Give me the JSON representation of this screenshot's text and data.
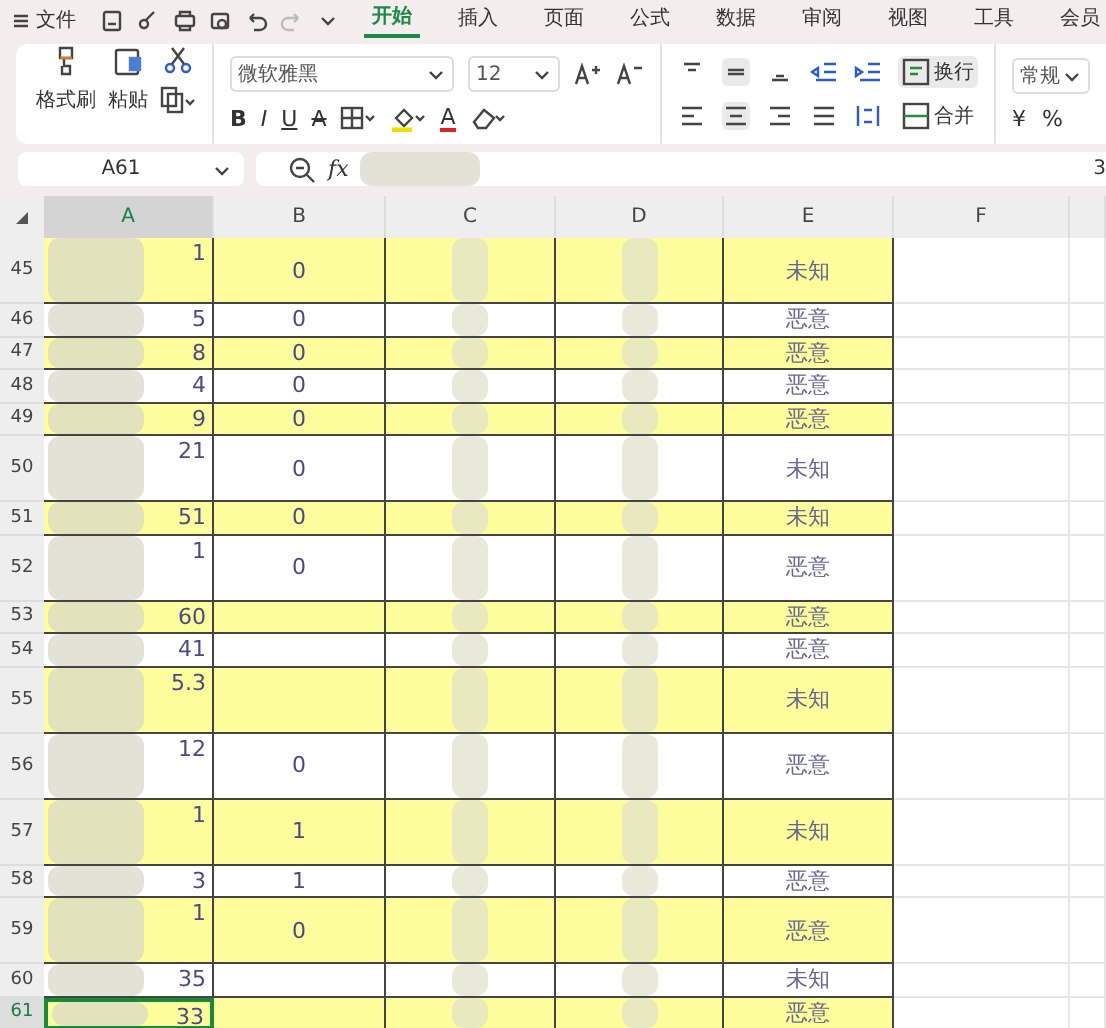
{
  "menu": {
    "file": "文件",
    "tabs": [
      {
        "label": "开始",
        "selected": true
      },
      {
        "label": "插入",
        "selected": false
      },
      {
        "label": "页面",
        "selected": false
      },
      {
        "label": "公式",
        "selected": false
      },
      {
        "label": "数据",
        "selected": false
      },
      {
        "label": "审阅",
        "selected": false
      },
      {
        "label": "视图",
        "selected": false
      },
      {
        "label": "工具",
        "selected": false
      },
      {
        "label": "会员",
        "selected": false
      }
    ]
  },
  "ribbon": {
    "format_painter": "格式刷",
    "paste": "粘贴",
    "font": "微软雅黑",
    "font_size": "12",
    "bold": "B",
    "italic": "I",
    "underline": "U",
    "strike": "A",
    "font_color": "A",
    "wrap": "换行",
    "merge": "合并",
    "number_format": "常规",
    "currency": "¥",
    "percent": "%"
  },
  "formula_bar": {
    "cell": "A61",
    "fx": "fx",
    "value": "3"
  },
  "columns": [
    "A",
    "B",
    "C",
    "D",
    "E",
    "F"
  ],
  "rows": [
    {
      "number": "45",
      "wrapped": true,
      "highlight": true,
      "selected": false,
      "a": "1",
      "b": "0",
      "e": "未知"
    },
    {
      "number": "46",
      "wrapped": false,
      "highlight": false,
      "selected": false,
      "a": "5",
      "b": "0",
      "e": "恶意"
    },
    {
      "number": "47",
      "wrapped": false,
      "highlight": true,
      "selected": false,
      "a": "8",
      "b": "0",
      "e": "恶意"
    },
    {
      "number": "48",
      "wrapped": false,
      "highlight": false,
      "selected": false,
      "a": "4",
      "b": "0",
      "e": "恶意"
    },
    {
      "number": "49",
      "wrapped": false,
      "highlight": true,
      "selected": false,
      "a": "9",
      "b": "0",
      "e": "恶意"
    },
    {
      "number": "50",
      "wrapped": true,
      "highlight": false,
      "selected": false,
      "a": "21",
      "b": "0",
      "e": "未知"
    },
    {
      "number": "51",
      "wrapped": false,
      "highlight": true,
      "selected": false,
      "a": "51",
      "b": "0",
      "e": "未知"
    },
    {
      "number": "52",
      "wrapped": true,
      "highlight": false,
      "selected": false,
      "a": "1",
      "b": "0",
      "e": "恶意"
    },
    {
      "number": "53",
      "wrapped": false,
      "highlight": true,
      "selected": false,
      "a": "60",
      "e": "恶意"
    },
    {
      "number": "54",
      "wrapped": false,
      "highlight": false,
      "selected": false,
      "a": "41",
      "e": "恶意"
    },
    {
      "number": "55",
      "wrapped": true,
      "highlight": true,
      "selected": false,
      "a": "5.3",
      "e": "未知"
    },
    {
      "number": "56",
      "wrapped": true,
      "highlight": false,
      "selected": false,
      "a": "12",
      "b": "0",
      "e": "恶意"
    },
    {
      "number": "57",
      "wrapped": true,
      "highlight": true,
      "selected": false,
      "a": "1",
      "b": "1",
      "e": "未知"
    },
    {
      "number": "58",
      "wrapped": false,
      "highlight": false,
      "selected": false,
      "a": "3",
      "b": "1",
      "e": "恶意"
    },
    {
      "number": "59",
      "wrapped": true,
      "highlight": true,
      "selected": false,
      "a": "1",
      "b": "0",
      "e": "恶意"
    },
    {
      "number": "60",
      "wrapped": false,
      "highlight": false,
      "selected": false,
      "a": "35",
      "e": "未知"
    },
    {
      "number": "61",
      "wrapped": false,
      "highlight": true,
      "selected": true,
      "a": "33",
      "e": "恶意"
    }
  ]
}
